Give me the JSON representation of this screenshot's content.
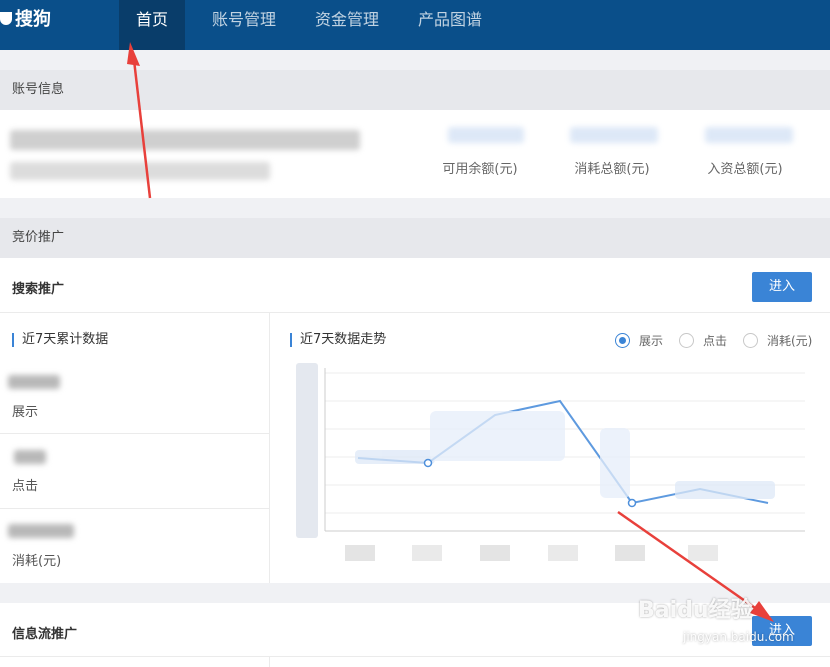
{
  "logo": {
    "text": "搜狗"
  },
  "nav": [
    {
      "label": "首页",
      "active": true
    },
    {
      "label": "账号管理",
      "active": false
    },
    {
      "label": "资金管理",
      "active": false
    },
    {
      "label": "产品图谱",
      "active": false
    }
  ],
  "account": {
    "section_title": "账号信息",
    "metrics": [
      {
        "label": "可用余额(元)"
      },
      {
        "label": "消耗总额(元)"
      },
      {
        "label": "入资总额(元)"
      }
    ]
  },
  "bidding": {
    "section_title": "竞价推广",
    "search_promo": {
      "title": "搜索推广",
      "enter_label": "进入",
      "cumulative_title": "近7天累计数据",
      "stats": [
        {
          "label": "展示"
        },
        {
          "label": "点击"
        },
        {
          "label": "消耗(元)"
        }
      ],
      "trend_title": "近7天数据走势",
      "radios": [
        {
          "label": "展示",
          "checked": true
        },
        {
          "label": "点击",
          "checked": false
        },
        {
          "label": "消耗(元)",
          "checked": false
        }
      ]
    },
    "feed_promo": {
      "title": "信息流推广",
      "enter_label": "进入"
    }
  },
  "watermark": {
    "brand": "Baidu经验",
    "url": "jingyan.baidu.com"
  },
  "colors": {
    "topbar": "#0a4f8a",
    "accent": "#3a84d6",
    "annotation": "#e8403b"
  }
}
